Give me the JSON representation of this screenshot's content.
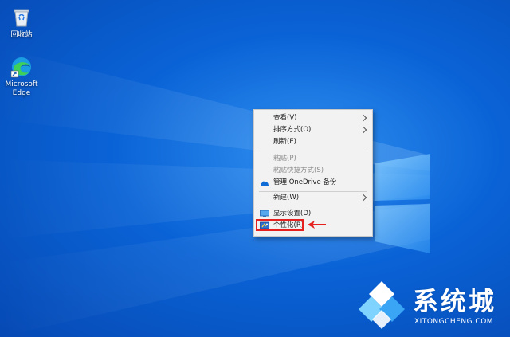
{
  "desktop": {
    "icons": [
      {
        "label": "回收站"
      },
      {
        "label": "Microsoft\nEdge"
      }
    ]
  },
  "context_menu": {
    "items": [
      {
        "label": "查看(V)",
        "submenu": true,
        "enabled": true
      },
      {
        "label": "排序方式(O)",
        "submenu": true,
        "enabled": true
      },
      {
        "label": "刷新(E)",
        "submenu": false,
        "enabled": true
      },
      {
        "label": "粘贴(P)",
        "submenu": false,
        "enabled": false
      },
      {
        "label": "粘贴快捷方式(S)",
        "submenu": false,
        "enabled": false
      },
      {
        "label": "管理 OneDrive 备份",
        "submenu": false,
        "enabled": true,
        "icon": "onedrive-cloud-icon"
      },
      {
        "label": "新建(W)",
        "submenu": true,
        "enabled": true
      },
      {
        "label": "显示设置(D)",
        "submenu": false,
        "enabled": true,
        "icon": "display-settings-icon"
      },
      {
        "label": "个性化(R)",
        "submenu": false,
        "enabled": true,
        "icon": "personalize-icon",
        "highlighted": true
      }
    ]
  },
  "annotation": {
    "highlight_color": "#e5201f"
  },
  "watermark": {
    "text": "系统城",
    "url": "XITONGCHENG.COM"
  },
  "colors": {
    "desktop_blue": "#0a63d6",
    "menu_bg": "#f2f2f2",
    "accent_red": "#e5201f"
  }
}
